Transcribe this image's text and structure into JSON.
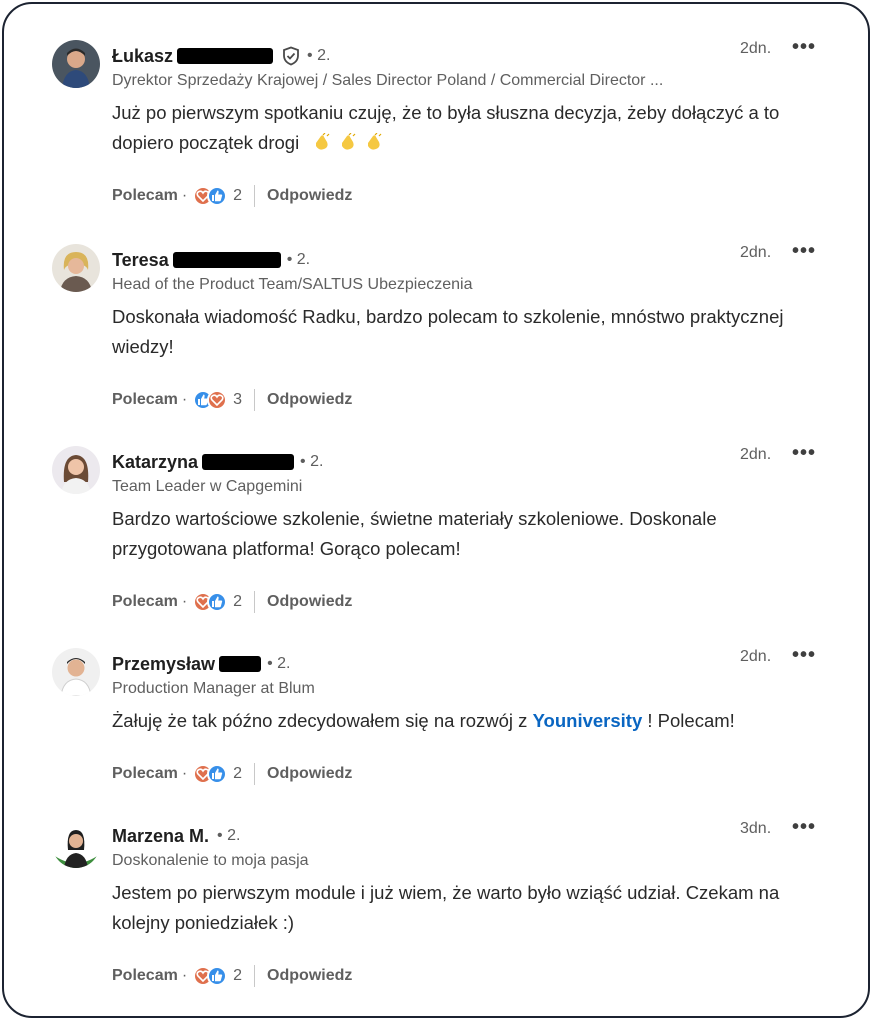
{
  "colors": {
    "accent": "#0a66c2",
    "love": "#df704d",
    "like": "#378fe9"
  },
  "comments": [
    {
      "name": "Łukasz",
      "verified": true,
      "degree": "• 2.",
      "subtitle": "Dyrektor Sprzedaży Krajowej / Sales Director Poland / Commercial Director ...",
      "time": "2dn.",
      "more": "•••",
      "text_before": "Już po pierwszym spotkaniu czuję, że to była słuszna decyzja, żeby dołączyć a to dopiero początek drogi",
      "text_mention": "",
      "text_after": "",
      "emoji": [
        "clapping-hands-icon",
        "clapping-hands-icon",
        "clapping-hands-icon"
      ],
      "like_label": "Polecam",
      "sep": "·",
      "reactions": [
        "love",
        "like"
      ],
      "reaction_count": "2",
      "reply_label": "Odpowiedz"
    },
    {
      "name": "Teresa",
      "verified": false,
      "degree": "• 2.",
      "subtitle": "Head of the Product Team/SALTUS Ubezpieczenia",
      "time": "2dn.",
      "more": "•••",
      "text_before": "Doskonała wiadomość Radku, bardzo polecam to szkolenie, mnóstwo praktycznej wiedzy!",
      "text_mention": "",
      "text_after": "",
      "emoji": [],
      "like_label": "Polecam",
      "sep": "·",
      "reactions": [
        "like",
        "love"
      ],
      "reaction_count": "3",
      "reply_label": "Odpowiedz"
    },
    {
      "name": "Katarzyna",
      "verified": false,
      "degree": "• 2.",
      "subtitle": "Team Leader w Capgemini",
      "time": "2dn.",
      "more": "•••",
      "text_before": "Bardzo wartościowe szkolenie, świetne materiały szkoleniowe. Doskonale przygotowana platforma! Gorąco polecam!",
      "text_mention": "",
      "text_after": "",
      "emoji": [],
      "like_label": "Polecam",
      "sep": "·",
      "reactions": [
        "love",
        "like"
      ],
      "reaction_count": "2",
      "reply_label": "Odpowiedz"
    },
    {
      "name": "Przemysław",
      "verified": false,
      "degree": "• 2.",
      "subtitle": "Production Manager at Blum",
      "time": "2dn.",
      "more": "•••",
      "text_before": "Żałuję że tak późno zdecydowałem się na rozwój z ",
      "text_mention": "Youniversity",
      "text_after": " ! Polecam!",
      "emoji": [],
      "like_label": "Polecam",
      "sep": "·",
      "reactions": [
        "love",
        "like"
      ],
      "reaction_count": "2",
      "reply_label": "Odpowiedz"
    },
    {
      "name": "Marzena M.",
      "verified": false,
      "degree": "• 2.",
      "subtitle": "Doskonalenie to moja pasja",
      "time": "3dn.",
      "more": "•••",
      "text_before": "Jestem po pierwszym module i już wiem, że warto było wziąść udział. Czekam na kolejny poniedziałek :)",
      "text_mention": "",
      "text_after": "",
      "emoji": [],
      "like_label": "Polecam",
      "sep": "·",
      "reactions": [
        "love",
        "like"
      ],
      "reaction_count": "2",
      "reply_label": "Odpowiedz"
    }
  ]
}
